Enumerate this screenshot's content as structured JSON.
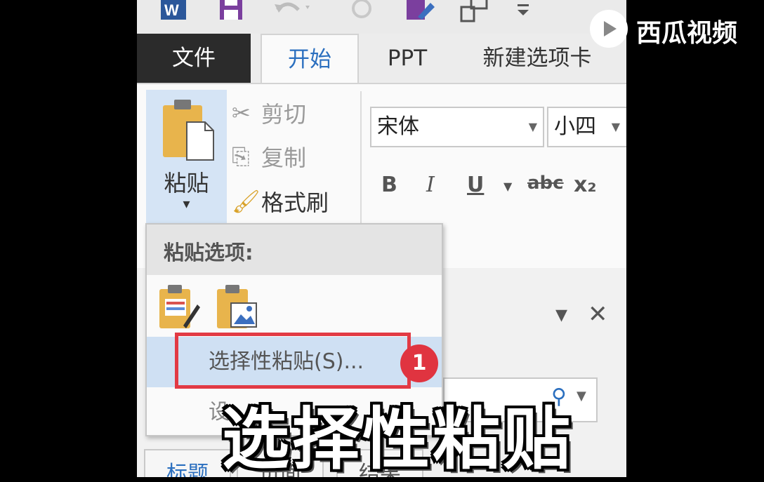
{
  "tabs": {
    "file": "文件",
    "home": "开始",
    "ppt": "PPT",
    "new_tab": "新建选项卡"
  },
  "clipboard": {
    "paste": "粘贴",
    "cut": "剪切",
    "copy": "复制",
    "format_painter": "格式刷"
  },
  "font": {
    "family": "宋体",
    "size": "小四"
  },
  "format_buttons": {
    "bold": "B",
    "italic": "I",
    "underline": "U",
    "strikethrough": "abc",
    "subscript": "x₂"
  },
  "paste_menu": {
    "header": "粘贴选项:",
    "paste_special": "选择性粘贴(S)...",
    "set_default_partial": "设"
  },
  "annotation": {
    "badge": "1",
    "highlight_color": "#e23a44"
  },
  "nav_pane": {
    "tabs": [
      "标题",
      "页面",
      "结果"
    ]
  },
  "subtitle": "选择性粘贴",
  "watermark": "西瓜视频",
  "colors": {
    "accent": "#2b6fbf",
    "file_tab": "#2b2b2b",
    "hover": "#cfe0f3"
  }
}
